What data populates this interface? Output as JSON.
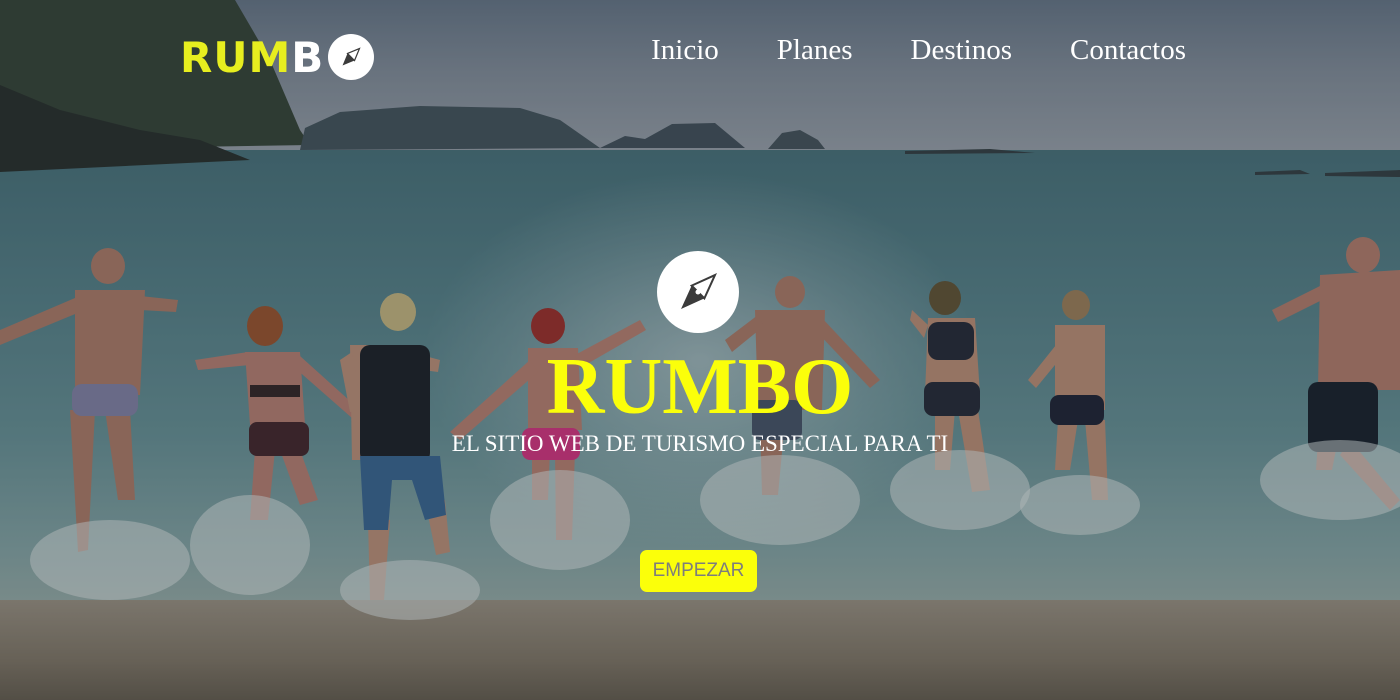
{
  "brand": {
    "logo_part1": "RUM",
    "logo_part2": "B",
    "accent": "#fbff0a",
    "logo_icon": "compass-icon"
  },
  "nav": {
    "items": [
      {
        "label": "Inicio"
      },
      {
        "label": "Planes"
      },
      {
        "label": "Destinos"
      },
      {
        "label": "Contactos"
      }
    ]
  },
  "hero": {
    "icon": "compass-icon",
    "title": "RUMBO",
    "subtitle": "EL SITIO WEB DE TURISMO ESPECIAL PARA TI",
    "cta_label": "EMPEZAR",
    "background": "beach-photo"
  }
}
